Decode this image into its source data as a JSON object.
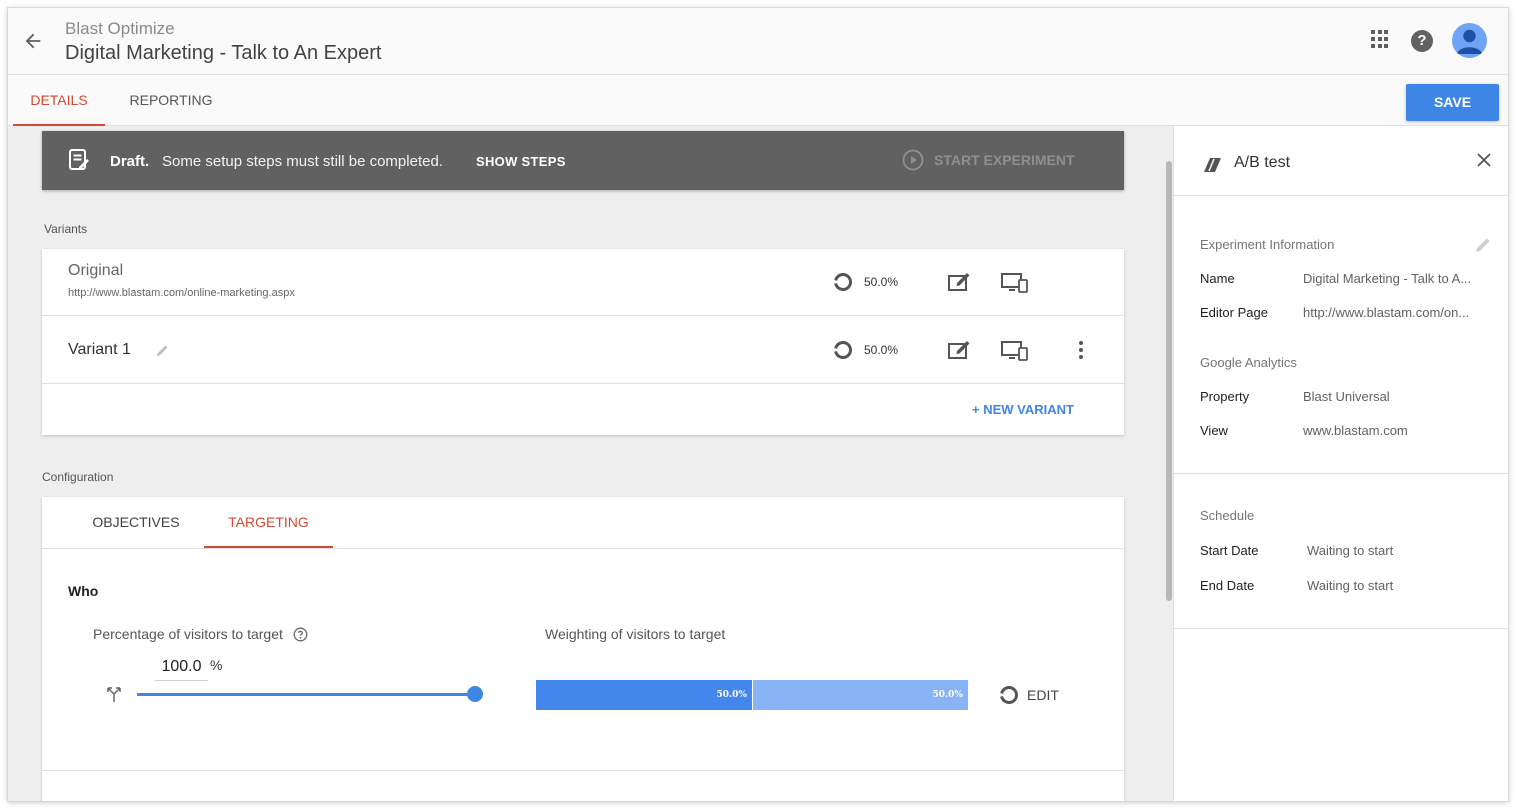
{
  "header": {
    "app_name": "Blast Optimize",
    "experiment_title": "Digital Marketing - Talk to An Expert"
  },
  "tabs": {
    "details": "DETAILS",
    "reporting": "REPORTING",
    "save": "SAVE"
  },
  "draft_banner": {
    "bold": "Draft.",
    "message": "Some setup steps must still be completed.",
    "show_steps": "SHOW STEPS",
    "start_experiment": "START EXPERIMENT"
  },
  "variants": {
    "section_label": "Variants",
    "rows": [
      {
        "name": "Original",
        "url": "http://www.blastam.com/online-marketing.aspx",
        "weight": "50.0%"
      },
      {
        "name": "Variant 1",
        "weight": "50.0%"
      }
    ],
    "new_variant": "+ NEW VARIANT"
  },
  "configuration": {
    "section_label": "Configuration",
    "tabs": [
      "OBJECTIVES",
      "TARGETING"
    ],
    "who_heading": "Who",
    "pct_label": "Percentage of visitors to target",
    "pct_value": "100.0",
    "pct_sign": "%",
    "weighting_label": "Weighting of visitors to target",
    "weights": [
      "50.0%",
      "50.0%"
    ],
    "slider_fraction": 1.0,
    "edit": "EDIT"
  },
  "panel": {
    "title": "A/B test",
    "experiment_info": {
      "heading": "Experiment Information",
      "name_label": "Name",
      "name_value": "Digital Marketing - Talk to A...",
      "editor_label": "Editor Page",
      "editor_value": "http://www.blastam.com/on..."
    },
    "analytics": {
      "heading": "Google Analytics",
      "property_label": "Property",
      "property_value": "Blast Universal",
      "view_label": "View",
      "view_value": "www.blastam.com"
    },
    "schedule": {
      "heading": "Schedule",
      "start_label": "Start Date",
      "start_value": "Waiting to start",
      "end_label": "End Date",
      "end_value": "Waiting to start"
    }
  },
  "colors": {
    "accent_red": "#d04a36",
    "primary_blue": "#3e86e6",
    "banner_gray": "#616161",
    "weight_a": "#4387ec",
    "weight_b": "#88b3f5"
  },
  "icons": [
    "back-arrow-icon",
    "apps-grid-icon",
    "help-icon",
    "avatar-icon",
    "document-edit-icon",
    "play-circle-icon",
    "donut-icon",
    "edit-square-icon",
    "devices-icon",
    "more-vert-icon",
    "pencil-icon",
    "split-icon",
    "question-circle-icon",
    "ab-test-icon",
    "close-icon"
  ]
}
